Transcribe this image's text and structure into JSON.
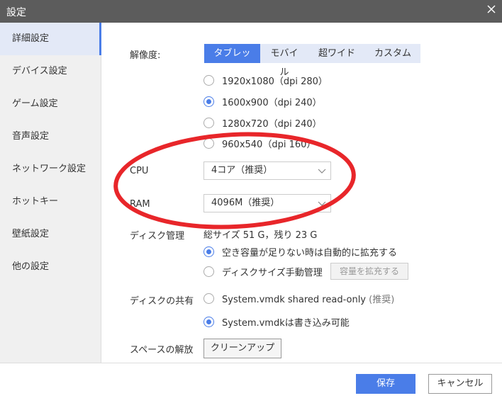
{
  "window": {
    "title": "設定",
    "close_icon": "close-icon"
  },
  "sidebar": {
    "items": [
      {
        "label": "詳細設定",
        "active": true
      },
      {
        "label": "デバイス設定"
      },
      {
        "label": "ゲーム設定"
      },
      {
        "label": "音声設定"
      },
      {
        "label": "ネットワーク設定"
      },
      {
        "label": "ホットキー"
      },
      {
        "label": "壁紙設定"
      },
      {
        "label": "他の設定"
      }
    ]
  },
  "resolution": {
    "label": "解像度:",
    "tabs": [
      "タブレット",
      "モバイル",
      "超ワイド",
      "カスタム"
    ],
    "active_tab": "タブレット",
    "options": [
      "1920x1080（dpi 280）",
      "1600x900（dpi 240）",
      "1280x720（dpi 240）",
      "960x540（dpi 160）"
    ],
    "selected": "1600x900（dpi 240）"
  },
  "cpu": {
    "label": "CPU",
    "value": "4コア（推奨）"
  },
  "ram": {
    "label": "RAM",
    "value": "4096M（推奨）"
  },
  "disk": {
    "label": "ディスク管理",
    "size_text": "総サイズ 51 G，残り 23 G",
    "auto_expand": "空き容量が足りない時は自動的に拡充する",
    "manual": "ディスクサイズ手動管理",
    "expand_button": "容量を拡充する",
    "selected": "auto"
  },
  "share": {
    "label": "ディスクの共有",
    "readonly": "System.vmdk shared read-only",
    "readonly_hint": "(推奨)",
    "writable": "System.vmdkは書き込み可能",
    "selected": "writable"
  },
  "space": {
    "label": "スペースの解放",
    "cleanup_button": "クリーンアップ"
  },
  "footer": {
    "save": "保存",
    "cancel": "キャンセル"
  },
  "colors": {
    "accent": "#4a7de8",
    "titlebar": "#5c5c5c",
    "annotation": "#e8262a"
  }
}
